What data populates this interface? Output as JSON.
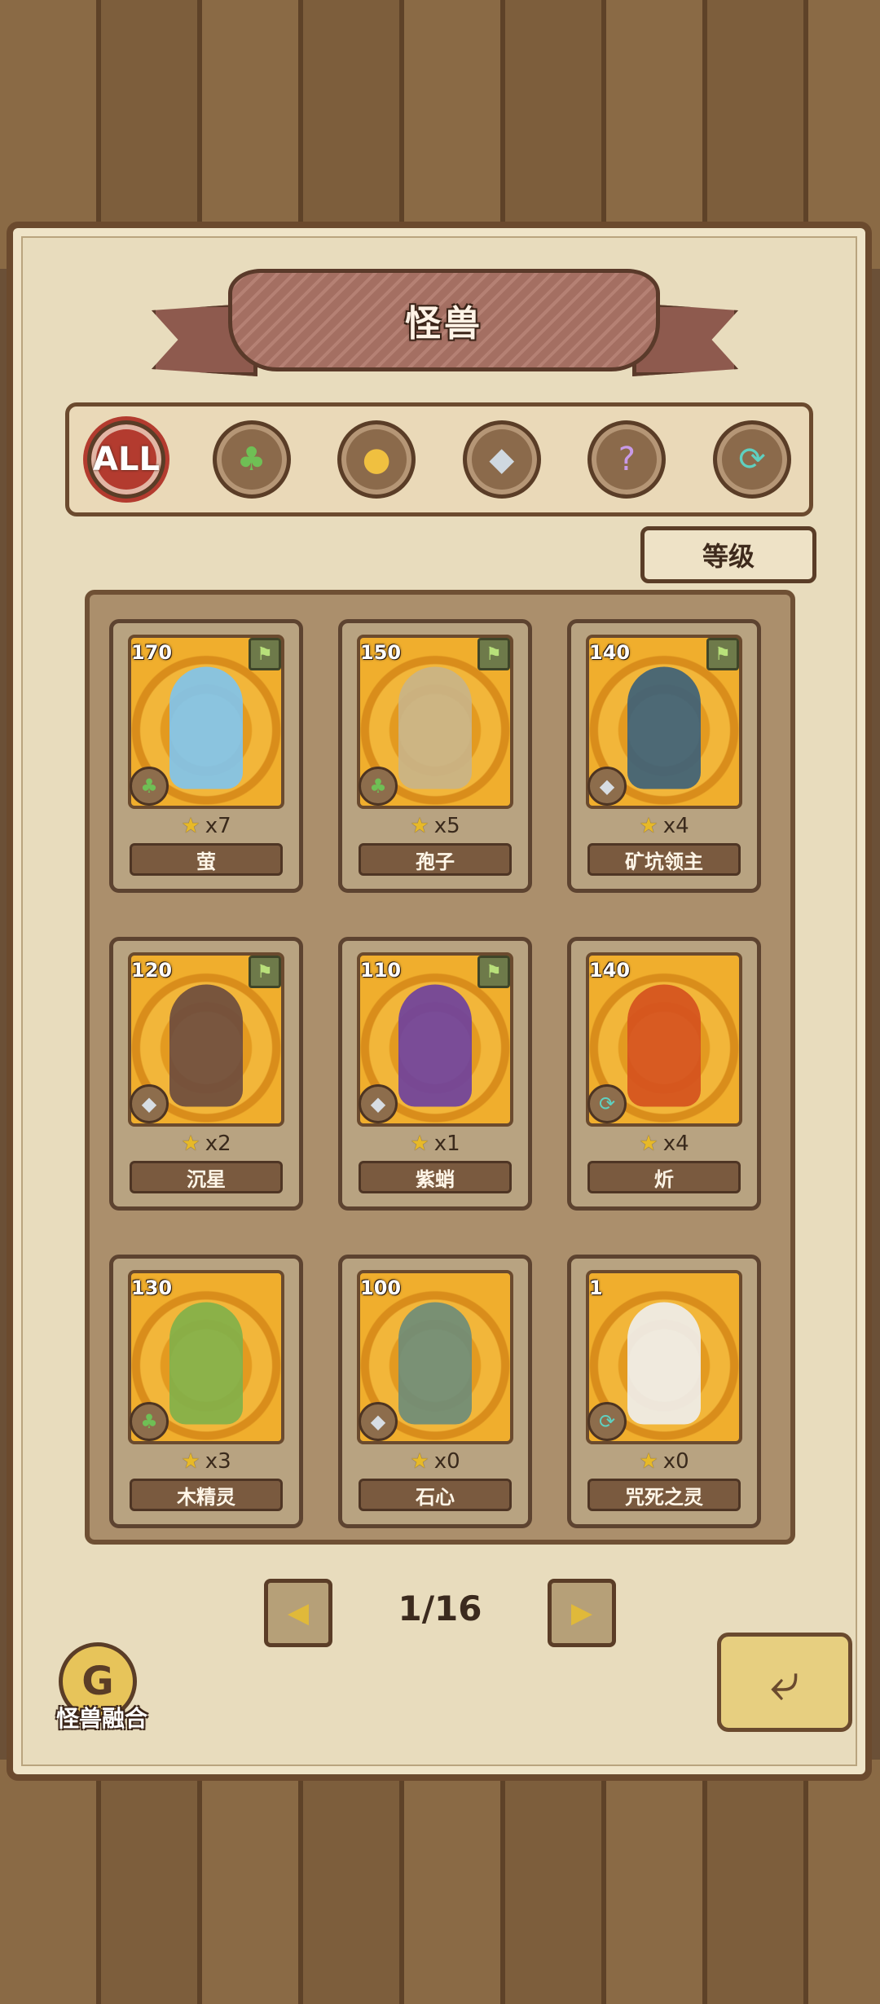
{
  "header": {
    "title": "怪兽"
  },
  "filters": [
    {
      "label": "ALL",
      "icon": "all-icon",
      "active": true
    },
    {
      "label": "",
      "icon": "leaf-icon"
    },
    {
      "label": "",
      "icon": "paw-icon"
    },
    {
      "label": "",
      "icon": "crystal-icon"
    },
    {
      "label": "",
      "icon": "question-icon"
    },
    {
      "label": "",
      "icon": "spiral-icon"
    }
  ],
  "sort_button": {
    "label": "等级"
  },
  "monsters": [
    {
      "name": "萤",
      "level": "170",
      "stars": "x7",
      "type_icon": "leaf-icon",
      "flag": true,
      "color": "#7ec4f0"
    },
    {
      "name": "孢子",
      "level": "150",
      "stars": "x5",
      "type_icon": "leaf-icon",
      "flag": true,
      "color": "#c8b48a"
    },
    {
      "name": "矿坑领主",
      "level": "140",
      "stars": "x4",
      "type_icon": "crystal-icon",
      "flag": true,
      "color": "#3a5f7a"
    },
    {
      "name": "沉星",
      "level": "120",
      "stars": "x2",
      "type_icon": "crystal-icon",
      "flag": true,
      "color": "#6a4a3e"
    },
    {
      "name": "紫蛸",
      "level": "110",
      "stars": "x1",
      "type_icon": "crystal-icon",
      "flag": true,
      "color": "#6b3fa0"
    },
    {
      "name": "炘",
      "level": "140",
      "stars": "x4",
      "type_icon": "spiral-icon",
      "flag": false,
      "color": "#d4501e"
    },
    {
      "name": "木精灵",
      "level": "130",
      "stars": "x3",
      "type_icon": "leaf-icon",
      "flag": false,
      "color": "#7fb04a"
    },
    {
      "name": "石心",
      "level": "100",
      "stars": "x0",
      "type_icon": "crystal-icon",
      "flag": false,
      "color": "#6c8c7a"
    },
    {
      "name": "咒死之灵",
      "level": "1",
      "stars": "x0",
      "type_icon": "spiral-icon",
      "flag": false,
      "color": "#eeeeee"
    }
  ],
  "pagination": {
    "page": "1/16"
  },
  "fusion_button": {
    "label": "怪兽融合"
  }
}
